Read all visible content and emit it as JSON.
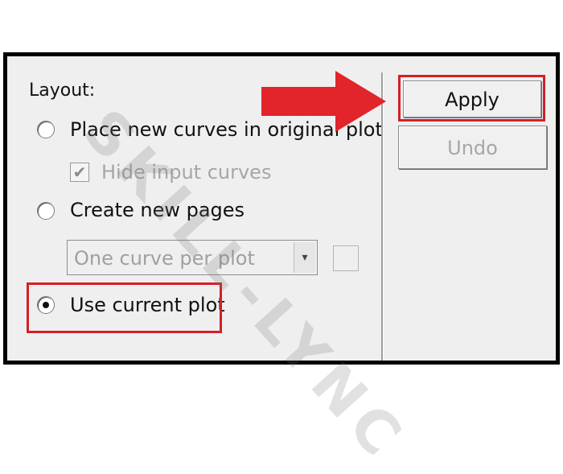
{
  "layout": {
    "heading": "Layout:",
    "options": [
      {
        "label": "Place new curves in original plot",
        "selected": false
      },
      {
        "label": "Create new pages",
        "selected": false
      },
      {
        "label": "Use current plot",
        "selected": true
      }
    ],
    "hide_input_curves": {
      "label": "Hide input curves",
      "checked": true,
      "disabled": true,
      "glyph": "✔"
    },
    "curve_dropdown": {
      "value": "One curve per plot",
      "disabled": true,
      "arrow": "▾"
    }
  },
  "buttons": {
    "apply_label": "Apply",
    "undo_label": "Undo"
  },
  "watermark": "SKILL-LYNC",
  "colors": {
    "highlight": "#d32027",
    "arrow": "#e2242b",
    "frame": "#000000",
    "panel": "#efefef"
  }
}
